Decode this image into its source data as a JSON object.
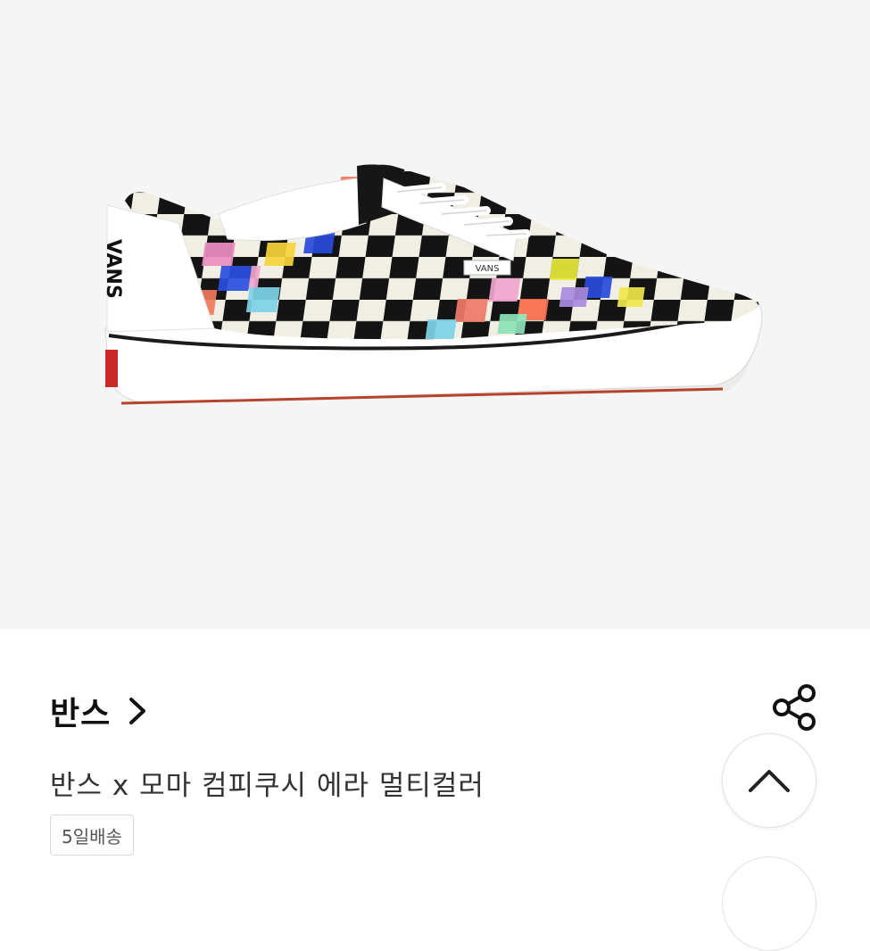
{
  "product_image": {
    "logo_text": "VANS",
    "heel_text": "VANS"
  },
  "brand": {
    "name": "반스"
  },
  "product": {
    "title": "반스 x 모마 컴피쿠시 에라 멀티컬러",
    "shipping_tag": "5일배송"
  },
  "icons": {
    "brand_arrow": "chevron-right-icon",
    "share": "share-icon",
    "scroll_top": "chevron-up-icon"
  },
  "colors": {
    "hero_bg": "#f5f5f5",
    "text_primary": "#111111",
    "text_secondary": "#333333",
    "tag_border": "#d8d8d8"
  }
}
